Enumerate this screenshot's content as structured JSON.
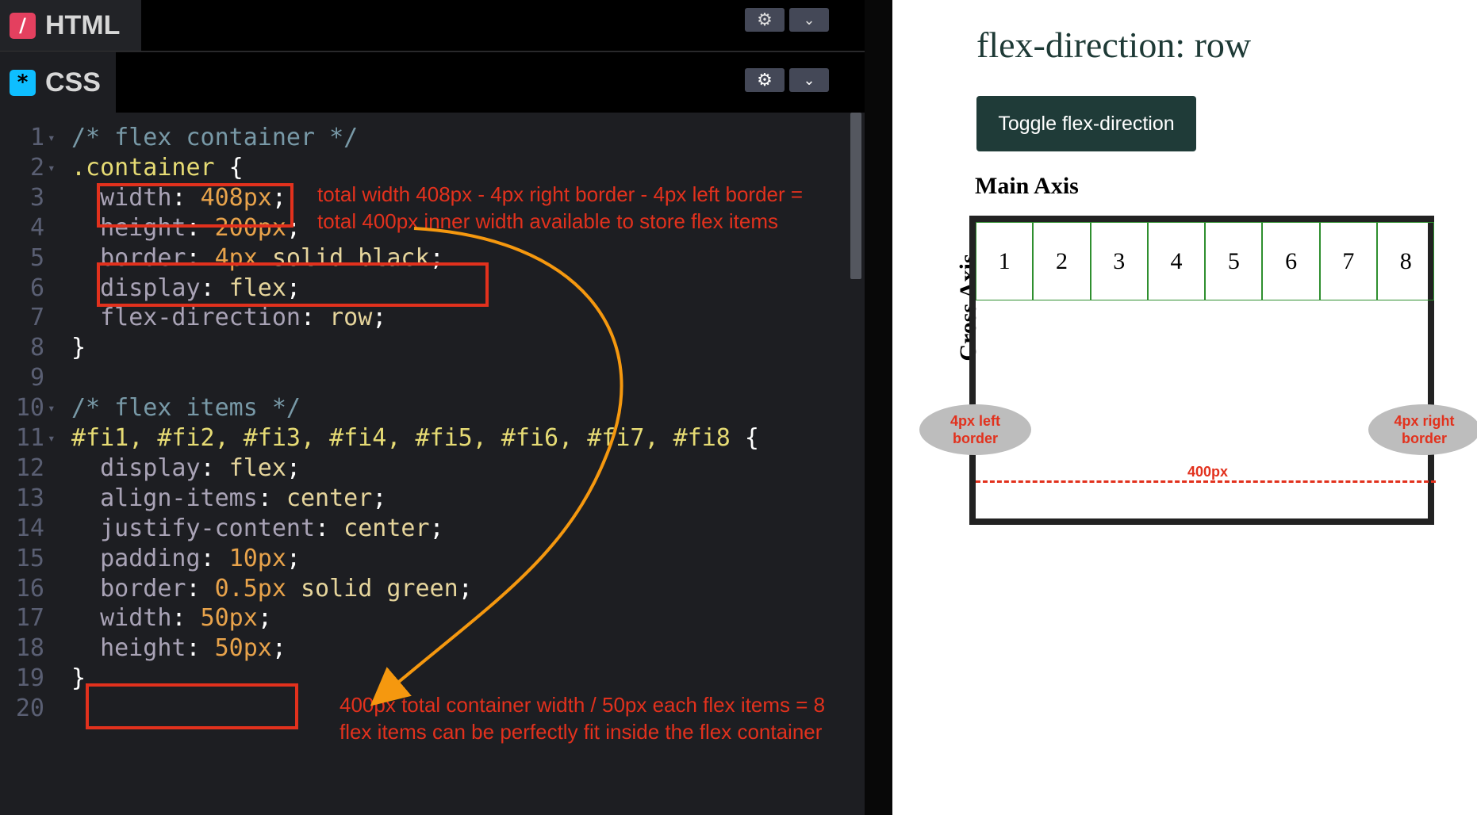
{
  "editor": {
    "html_tab": "HTML",
    "css_tab": "CSS",
    "code_lines": [
      {
        "n": "1",
        "fold": true,
        "tokens": [
          [
            "cm",
            "/* flex container */"
          ]
        ]
      },
      {
        "n": "2",
        "fold": true,
        "tokens": [
          [
            "sel",
            ".container"
          ],
          [
            "pun",
            " {"
          ]
        ]
      },
      {
        "n": "3",
        "tokens": [
          [
            "prop",
            "  width"
          ],
          [
            "pun",
            ": "
          ],
          [
            "val",
            "408px"
          ],
          [
            "pun",
            ";"
          ]
        ]
      },
      {
        "n": "4",
        "tokens": [
          [
            "prop",
            "  height"
          ],
          [
            "pun",
            ": "
          ],
          [
            "val",
            "200px"
          ],
          [
            "pun",
            ";"
          ]
        ]
      },
      {
        "n": "5",
        "tokens": [
          [
            "prop",
            "  border"
          ],
          [
            "pun",
            ": "
          ],
          [
            "val",
            "4px"
          ],
          [
            "kw",
            " solid black"
          ],
          [
            "pun",
            ";"
          ]
        ]
      },
      {
        "n": "6",
        "tokens": [
          [
            "prop",
            "  display"
          ],
          [
            "pun",
            ": "
          ],
          [
            "kw",
            "flex"
          ],
          [
            "pun",
            ";"
          ]
        ]
      },
      {
        "n": "7",
        "tokens": [
          [
            "prop",
            "  flex-direction"
          ],
          [
            "pun",
            ": "
          ],
          [
            "kw",
            "row"
          ],
          [
            "pun",
            ";"
          ]
        ]
      },
      {
        "n": "8",
        "tokens": [
          [
            "pun",
            "}"
          ]
        ]
      },
      {
        "n": "9",
        "tokens": []
      },
      {
        "n": "10",
        "fold": true,
        "tokens": [
          [
            "cm",
            "/* flex items */"
          ]
        ]
      },
      {
        "n": "11",
        "fold": true,
        "tokens": [
          [
            "sel",
            "#fi1, #fi2, #fi3, #fi4, #fi5, #fi6, #fi7, #fi8"
          ],
          [
            "pun",
            " {"
          ]
        ]
      },
      {
        "n": "12",
        "tokens": [
          [
            "prop",
            "  display"
          ],
          [
            "pun",
            ": "
          ],
          [
            "kw",
            "flex"
          ],
          [
            "pun",
            ";"
          ]
        ]
      },
      {
        "n": "13",
        "tokens": [
          [
            "prop",
            "  align-items"
          ],
          [
            "pun",
            ": "
          ],
          [
            "kw",
            "center"
          ],
          [
            "pun",
            ";"
          ]
        ]
      },
      {
        "n": "14",
        "tokens": [
          [
            "prop",
            "  justify-content"
          ],
          [
            "pun",
            ": "
          ],
          [
            "kw",
            "center"
          ],
          [
            "pun",
            ";"
          ]
        ]
      },
      {
        "n": "15",
        "tokens": [
          [
            "prop",
            "  padding"
          ],
          [
            "pun",
            ": "
          ],
          [
            "val",
            "10px"
          ],
          [
            "pun",
            ";"
          ]
        ]
      },
      {
        "n": "16",
        "tokens": [
          [
            "prop",
            "  border"
          ],
          [
            "pun",
            ": "
          ],
          [
            "val",
            "0.5px"
          ],
          [
            "kw",
            " solid green"
          ],
          [
            "pun",
            ";"
          ]
        ]
      },
      {
        "n": "17",
        "tokens": [
          [
            "prop",
            "  width"
          ],
          [
            "pun",
            ": "
          ],
          [
            "val",
            "50px"
          ],
          [
            "pun",
            ";"
          ]
        ]
      },
      {
        "n": "18",
        "tokens": [
          [
            "prop",
            "  height"
          ],
          [
            "pun",
            ": "
          ],
          [
            "val",
            "50px"
          ],
          [
            "pun",
            ";"
          ]
        ]
      },
      {
        "n": "19",
        "tokens": [
          [
            "pun",
            "}"
          ]
        ]
      },
      {
        "n": "20",
        "tokens": []
      }
    ]
  },
  "annotations": {
    "note1": "total width 408px - 4px right border - 4px left border = total 400px inner width available to store flex items",
    "note2": "400px total container width / 50px each flex items = 8 flex items can be perfectly fit inside the flex container"
  },
  "preview": {
    "title": "flex-direction: row",
    "toggle_label": "Toggle flex-direction",
    "main_axis": "Main Axis",
    "cross_axis": "Cross Axis",
    "items": [
      "1",
      "2",
      "3",
      "4",
      "5",
      "6",
      "7",
      "8"
    ],
    "left_border_label": "4px left border",
    "right_border_label": "4px right border",
    "inner_width_label": "400px"
  },
  "colors": {
    "annotation_red": "#e2311d",
    "arrow_orange": "#f5980f",
    "button_bg": "#1f3b38"
  }
}
